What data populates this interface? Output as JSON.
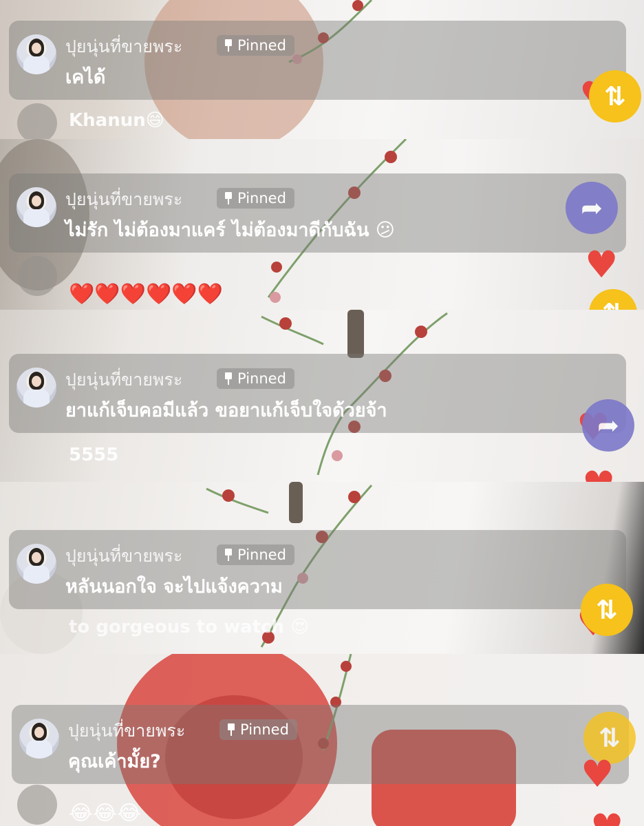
{
  "comments": [
    {
      "name": "ปุยนุ่นที่ขายพระ",
      "badge": "Pinned",
      "message": "เคได้",
      "under_user": "Khanun",
      "under_text": "😄"
    },
    {
      "name": "ปุยนุ่นที่ขายพระ",
      "badge": "Pinned",
      "message": "ไม่รัก ไม่ต้องมาแคร์ ไม่ต้องมาดีกับฉัน 😕",
      "under_text": "❤️❤️❤️❤️❤️❤️"
    },
    {
      "name": "ปุยนุ่นที่ขายพระ",
      "badge": "Pinned",
      "message": "ยาแก้เจ็บคอมีแล้ว ขอยาแก้เจ็บใจด้วยจ้า",
      "under_text": "5555"
    },
    {
      "name": "ปุยนุ่นที่ขายพระ",
      "badge": "Pinned",
      "message": "หลันนอกใจ จะไปแจ้งความ",
      "under_text": "to gorgeous to watch 😍"
    },
    {
      "name": "ปุยนุ่นที่ขายพระ",
      "badge": "Pinned",
      "message": "คุณเค้ามั้ย?",
      "under_text": "😂😂😂"
    }
  ],
  "icons": {
    "repost": "repost-icon",
    "share": "share-icon",
    "like": "heart-icon"
  },
  "colors": {
    "repost_button": "#f6c21b",
    "share_button": "#7c78c9",
    "heart": "#e8463f"
  }
}
